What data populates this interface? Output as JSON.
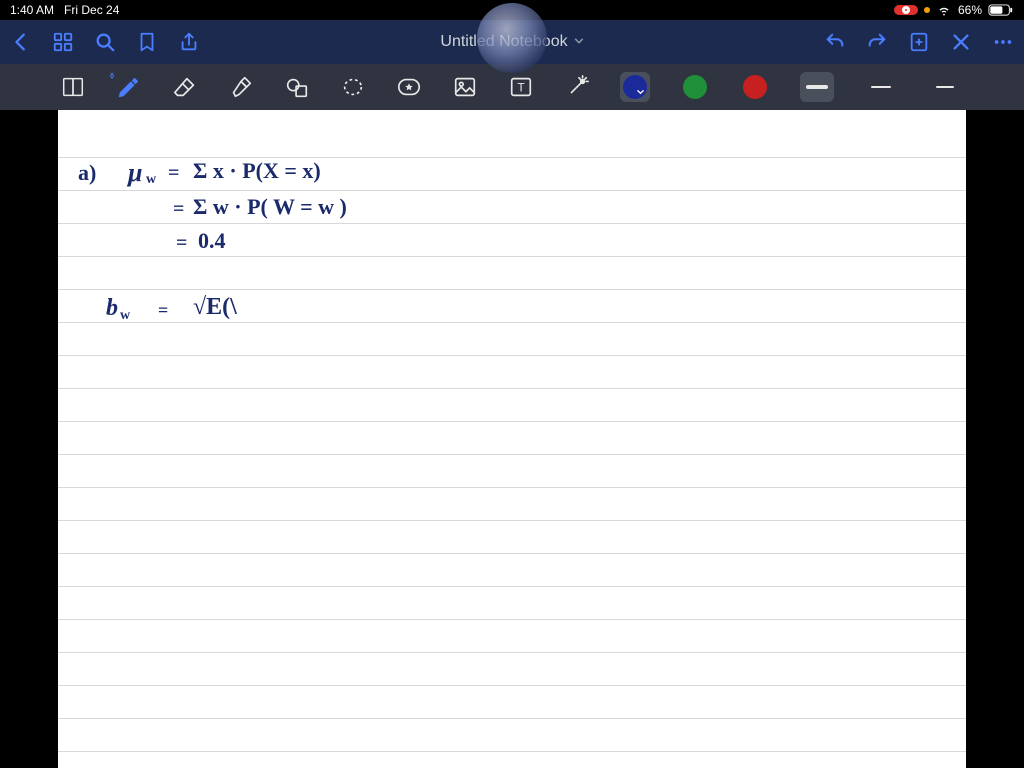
{
  "status": {
    "time": "1:40 AM",
    "date": "Fri Dec 24",
    "battery_pct": "66%"
  },
  "nav": {
    "title": "Untitled Notebook"
  },
  "tools": {
    "colors": {
      "blue": "#1b2a9b",
      "green": "#1f8f3a",
      "red": "#c62020"
    }
  },
  "handwriting": {
    "l1a": "a)",
    "l1b": "μ",
    "l1bsub": "w",
    "l1c": "=",
    "l1d": "Σ x · P(X = x)",
    "l2a": "=",
    "l2b": "Σ w · P( W = w )",
    "l3a": "=",
    "l3b": "0.4",
    "l4a": "b",
    "l4asub": "w",
    "l4b": "=",
    "l4c": "√E(\\"
  }
}
